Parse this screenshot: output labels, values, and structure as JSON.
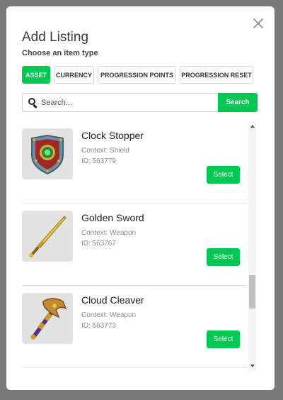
{
  "dialog": {
    "title": "Add Listing",
    "subtitle": "Choose an item type",
    "close_icon": "close-icon"
  },
  "item_types": [
    {
      "label": "ASSET",
      "active": true
    },
    {
      "label": "CURRENCY",
      "active": false
    },
    {
      "label": "PROGRESSION POINTS",
      "active": false
    },
    {
      "label": "PROGRESSION RESET",
      "active": false
    }
  ],
  "search": {
    "placeholder": "Search...",
    "value": "",
    "button_label": "Search",
    "icon": "search-icon"
  },
  "items": [
    {
      "name": "Clock Stopper",
      "context": "Context: Shield",
      "id": "ID: 563779",
      "select_label": "Select",
      "icon": "shield-icon"
    },
    {
      "name": "Golden Sword",
      "context": "Context: Weapon",
      "id": "ID: 563767",
      "select_label": "Select",
      "icon": "sword-icon"
    },
    {
      "name": "Cloud Cleaver",
      "context": "Context: Weapon",
      "id": "ID: 563773",
      "select_label": "Select",
      "icon": "axe-icon"
    }
  ],
  "colors": {
    "accent": "#00c853",
    "overlay": "#7a7a7a"
  }
}
